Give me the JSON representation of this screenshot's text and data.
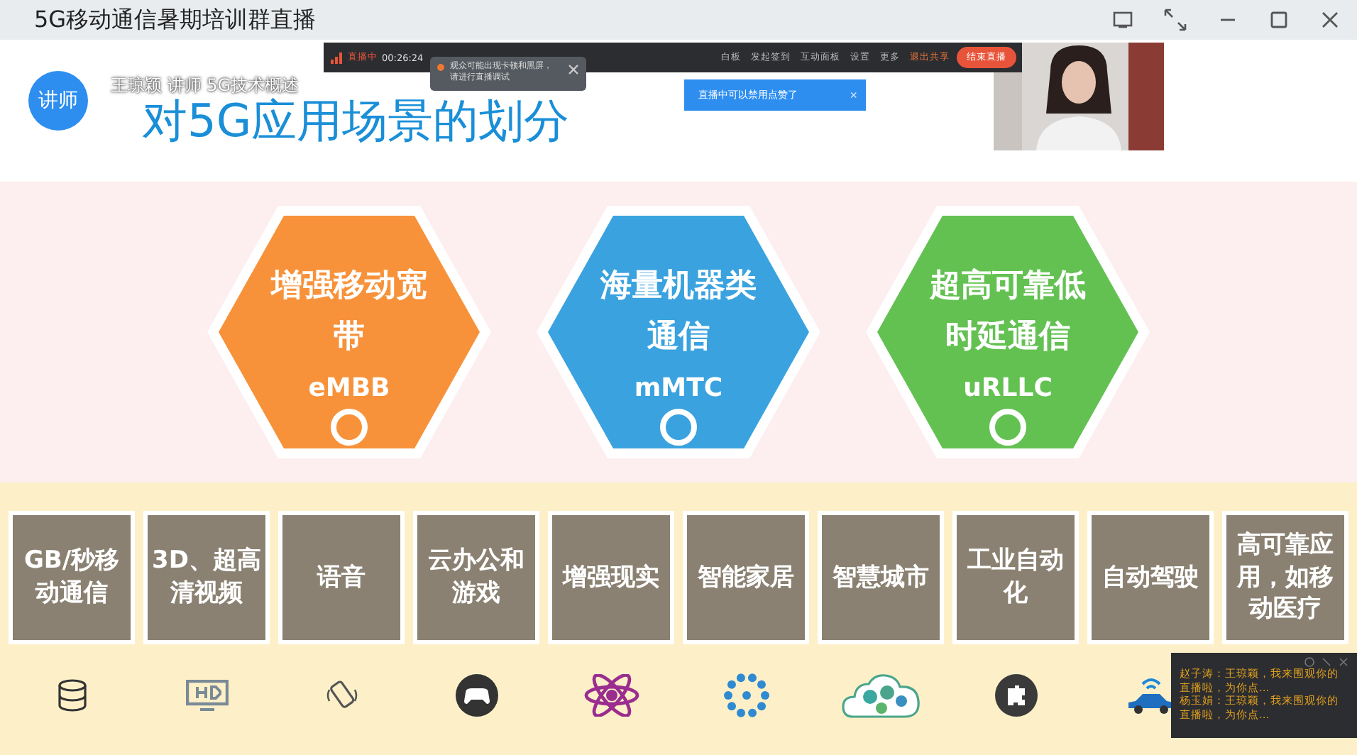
{
  "window": {
    "title": "5G移动通信暑期培训群直播"
  },
  "toolbar": {
    "status": "直播中",
    "time": "00:26:24",
    "items": [
      "白板",
      "发起签到",
      "互动面板",
      "设置",
      "更多"
    ],
    "exit_share": "退出共享",
    "end_button": "结束直播"
  },
  "notice": {
    "lines": [
      "观众可能出现卡顿和黑屏，",
      "请进行直播调试"
    ]
  },
  "toast": {
    "text": "直播中可以禁用点赞了",
    "close": "×"
  },
  "presenter": {
    "badge": "讲师",
    "caption": "王琼颖 讲师 5G技术概述"
  },
  "slide": {
    "title": "对5G应用场景的划分",
    "scenarios": [
      {
        "name": "增强移动宽带",
        "code": "eMBB",
        "color": "#f7923a"
      },
      {
        "name": "海量机器类通信",
        "code": "mMTC",
        "color": "#3aa2df"
      },
      {
        "name": "超高可靠低时延通信",
        "code": "uRLLC",
        "color": "#63c152"
      }
    ],
    "applications": [
      "GB/秒移动通信",
      "3D、超高清视频",
      "语音",
      "云办公和游戏",
      "增强现实",
      "智能家居",
      "智慧城市",
      "工业自动化",
      "自动驾驶",
      "高可靠应用，如移动医疗"
    ]
  },
  "chat": {
    "messages": [
      "赵子涛：王琼颖，我来围观你的直播啦，为你点...",
      "杨玉娟：王琼颖，我来围观你的直播啦，为你点..."
    ]
  }
}
